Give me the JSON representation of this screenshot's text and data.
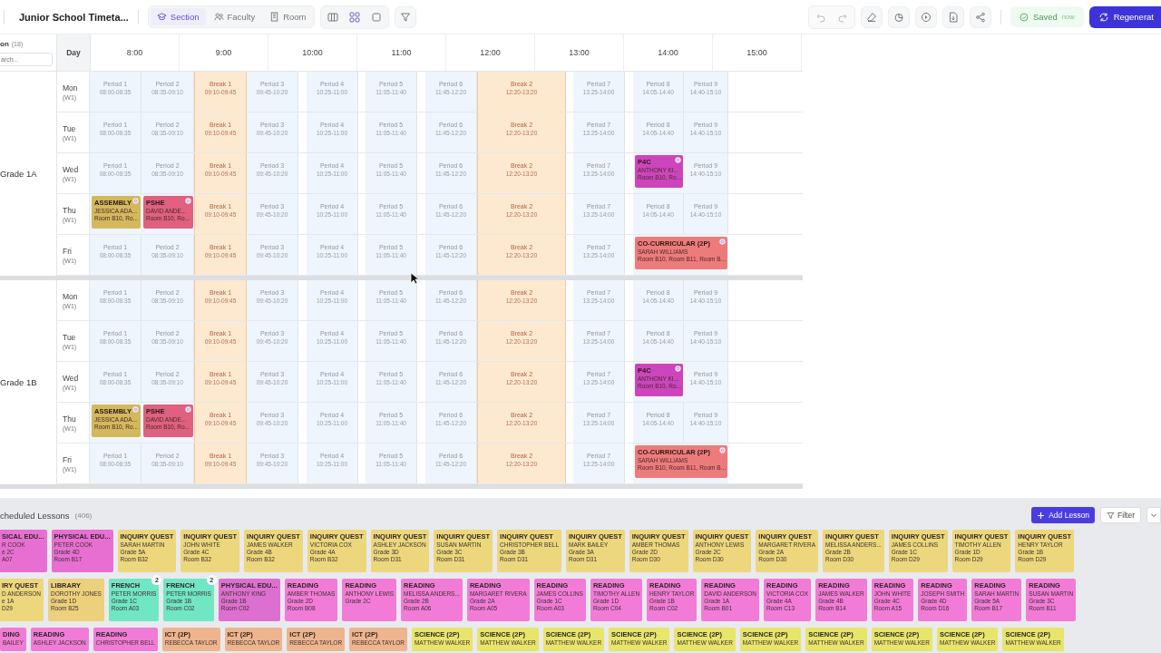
{
  "toolbar": {
    "title": "Junior School Timeta...",
    "views": [
      {
        "label": "Section",
        "selected": true
      },
      {
        "label": "Faculty",
        "selected": false
      },
      {
        "label": "Room",
        "selected": false
      }
    ],
    "layouts": [
      {
        "selected": false
      },
      {
        "selected": true
      },
      {
        "selected": false
      }
    ],
    "save_status": "Saved",
    "save_time": "now",
    "primary_button": "Regenerat"
  },
  "side_header": {
    "label": "on",
    "count": "(18)",
    "search": {
      "placeholder": "arch..."
    }
  },
  "timetable": {
    "day_heading": "Day",
    "hours": [
      "8:00",
      "9:00",
      "10:00",
      "11:00",
      "12:00",
      "13:00",
      "14:00",
      "15:00"
    ],
    "sections": [
      {
        "grade": "Grade 1A",
        "days": [
          {
            "day": "Mon",
            "week": "(W1)",
            "slots": [
              {
                "kind": "period",
                "label": "Period 1",
                "time": "08:00-08:35"
              },
              {
                "kind": "period",
                "label": "Period 2",
                "time": "08:35-09:10"
              },
              {
                "kind": "break",
                "label": "Break 1",
                "time": "09:10-09:45"
              },
              {
                "kind": "period",
                "label": "Period 3",
                "time": "09:45-10:20"
              },
              {
                "kind": "period",
                "label": "Period 4",
                "time": "10:25-11:00"
              },
              {
                "kind": "period",
                "label": "Period 5",
                "time": "11:05-11:40"
              },
              {
                "kind": "period",
                "label": "Period 6",
                "time": "11:45-12:20"
              },
              {
                "kind": "break",
                "label": "Break 2",
                "time": "12:20-13:20"
              },
              {
                "kind": "period",
                "label": "Period 7",
                "time": "13:25-14:00"
              },
              {
                "kind": "period",
                "label": "Period 8",
                "time": "14:05-14:40"
              },
              {
                "kind": "period",
                "label": "Period 9",
                "time": "14:40-15:10"
              }
            ]
          },
          {
            "day": "Tue",
            "week": "(W1)",
            "slots": [
              {
                "kind": "period",
                "label": "Period 1",
                "time": "08:00-08:35"
              },
              {
                "kind": "period",
                "label": "Period 2",
                "time": "08:35-09:10"
              },
              {
                "kind": "break",
                "label": "Break 1",
                "time": "09:10-09:45"
              },
              {
                "kind": "period",
                "label": "Period 3",
                "time": "09:45-10:20"
              },
              {
                "kind": "period",
                "label": "Period 4",
                "time": "10:25-11:00"
              },
              {
                "kind": "period",
                "label": "Period 5",
                "time": "11:05-11:40"
              },
              {
                "kind": "period",
                "label": "Period 6",
                "time": "11:45-12:20"
              },
              {
                "kind": "break",
                "label": "Break 2",
                "time": "12:20-13:20"
              },
              {
                "kind": "period",
                "label": "Period 7",
                "time": "13:25-14:00"
              },
              {
                "kind": "period",
                "label": "Period 8",
                "time": "14:05-14:40"
              },
              {
                "kind": "period",
                "label": "Period 9",
                "time": "14:40-15:10"
              }
            ]
          },
          {
            "day": "Wed",
            "week": "(W1)",
            "slots": [
              {
                "kind": "period",
                "label": "Period 1",
                "time": "08:00-08:35"
              },
              {
                "kind": "period",
                "label": "Period 2",
                "time": "08:35-09:10"
              },
              {
                "kind": "break",
                "label": "Break 1",
                "time": "09:10-09:45"
              },
              {
                "kind": "period",
                "label": "Period 3",
                "time": "09:45-10:20"
              },
              {
                "kind": "period",
                "label": "Period 4",
                "time": "10:25-11:00"
              },
              {
                "kind": "period",
                "label": "Period 5",
                "time": "11:05-11:40"
              },
              {
                "kind": "period",
                "label": "Period 6",
                "time": "11:45-12:20"
              },
              {
                "kind": "break",
                "label": "Break 2",
                "time": "12:20-13:20"
              },
              {
                "kind": "period",
                "label": "Period 7",
                "time": "13:25-14:00"
              },
              {
                "kind": "lesson",
                "subject": "P4C",
                "teacher": "ANTHONY KI...",
                "room": "Room B10, Ro...",
                "color": "#cc45bd",
                "double": false
              },
              {
                "kind": "period",
                "label": "Period 9",
                "time": "14:40-15:10"
              }
            ]
          },
          {
            "day": "Thu",
            "week": "(W1)",
            "slots": [
              {
                "kind": "lesson",
                "subject": "ASSEMBLY",
                "teacher": "JESSICA ADA...",
                "room": "Room B10, Ro...",
                "color": "#d4b85c",
                "double": false
              },
              {
                "kind": "lesson",
                "subject": "PSHE",
                "teacher": "DAVID ANDE...",
                "room": "Room B10, Ro...",
                "color": "#e0607f",
                "double": false
              },
              {
                "kind": "break",
                "label": "Break 1",
                "time": "09:10-09:45"
              },
              {
                "kind": "period",
                "label": "Period 3",
                "time": "09:45-10:20"
              },
              {
                "kind": "period",
                "label": "Period 4",
                "time": "10:25-11:00"
              },
              {
                "kind": "period",
                "label": "Period 5",
                "time": "11:05-11:40"
              },
              {
                "kind": "period",
                "label": "Period 6",
                "time": "11:45-12:20"
              },
              {
                "kind": "break",
                "label": "Break 2",
                "time": "12:20-13:20"
              },
              {
                "kind": "period",
                "label": "Period 7",
                "time": "13:25-14:00"
              },
              {
                "kind": "period",
                "label": "Period 8",
                "time": "14:05-14:40"
              },
              {
                "kind": "period",
                "label": "Period 9",
                "time": "14:40-15:10"
              }
            ]
          },
          {
            "day": "Fri",
            "week": "(W1)",
            "slots": [
              {
                "kind": "period",
                "label": "Period 1",
                "time": "08:00-08:35"
              },
              {
                "kind": "period",
                "label": "Period 2",
                "time": "08:35-09:10"
              },
              {
                "kind": "break",
                "label": "Break 1",
                "time": "09:10-09:45"
              },
              {
                "kind": "period",
                "label": "Period 3",
                "time": "09:45-10:20"
              },
              {
                "kind": "period",
                "label": "Period 4",
                "time": "10:25-11:00"
              },
              {
                "kind": "period",
                "label": "Period 5",
                "time": "11:05-11:40"
              },
              {
                "kind": "period",
                "label": "Period 6",
                "time": "11:45-12:20"
              },
              {
                "kind": "break",
                "label": "Break 2",
                "time": "12:20-13:20"
              },
              {
                "kind": "period",
                "label": "Period 7",
                "time": "13:25-14:00"
              },
              {
                "kind": "lesson",
                "subject": "CO-CURRICULAR (2P)",
                "teacher": "SARAH WILLIAMS",
                "room": "Room B10, Room B11, Room B...",
                "color": "#ee7b7b",
                "double": true
              }
            ]
          }
        ]
      },
      {
        "grade": "Grade 1B",
        "days": [
          {
            "day": "Mon",
            "week": "(W1)",
            "slots": [
              {
                "kind": "period",
                "label": "Period 1",
                "time": "08:00-08:35"
              },
              {
                "kind": "period",
                "label": "Period 2",
                "time": "08:35-09:10"
              },
              {
                "kind": "break",
                "label": "Break 1",
                "time": "09:10-09:45"
              },
              {
                "kind": "period",
                "label": "Period 3",
                "time": "09:45-10:20"
              },
              {
                "kind": "period",
                "label": "Period 4",
                "time": "10:25-11:00"
              },
              {
                "kind": "period",
                "label": "Period 5",
                "time": "11:05-11:40"
              },
              {
                "kind": "period",
                "label": "Period 6",
                "time": "11:45-12:20"
              },
              {
                "kind": "break",
                "label": "Break 2",
                "time": "12:20-13:20"
              },
              {
                "kind": "period",
                "label": "Period 7",
                "time": "13:25-14:00"
              },
              {
                "kind": "period",
                "label": "Period 8",
                "time": "14:05-14:40"
              },
              {
                "kind": "period",
                "label": "Period 9",
                "time": "14:40-15:10"
              }
            ]
          },
          {
            "day": "Tue",
            "week": "(W1)",
            "slots": [
              {
                "kind": "period",
                "label": "Period 1",
                "time": "08:00-08:35"
              },
              {
                "kind": "period",
                "label": "Period 2",
                "time": "08:35-09:10"
              },
              {
                "kind": "break",
                "label": "Break 1",
                "time": "09:10-09:45"
              },
              {
                "kind": "period",
                "label": "Period 3",
                "time": "09:45-10:20"
              },
              {
                "kind": "period",
                "label": "Period 4",
                "time": "10:25-11:00"
              },
              {
                "kind": "period",
                "label": "Period 5",
                "time": "11:05-11:40"
              },
              {
                "kind": "period",
                "label": "Period 6",
                "time": "11:45-12:20"
              },
              {
                "kind": "break",
                "label": "Break 2",
                "time": "12:20-13:20"
              },
              {
                "kind": "period",
                "label": "Period 7",
                "time": "13:25-14:00"
              },
              {
                "kind": "period",
                "label": "Period 8",
                "time": "14:05-14:40"
              },
              {
                "kind": "period",
                "label": "Period 9",
                "time": "14:40-15:10"
              }
            ]
          },
          {
            "day": "Wed",
            "week": "(W1)",
            "slots": [
              {
                "kind": "period",
                "label": "Period 1",
                "time": "08:00-08:35"
              },
              {
                "kind": "period",
                "label": "Period 2",
                "time": "08:35-09:10"
              },
              {
                "kind": "break",
                "label": "Break 1",
                "time": "09:10-09:45"
              },
              {
                "kind": "period",
                "label": "Period 3",
                "time": "09:45-10:20"
              },
              {
                "kind": "period",
                "label": "Period 4",
                "time": "10:25-11:00"
              },
              {
                "kind": "period",
                "label": "Period 5",
                "time": "11:05-11:40"
              },
              {
                "kind": "period",
                "label": "Period 6",
                "time": "11:45-12:20"
              },
              {
                "kind": "break",
                "label": "Break 2",
                "time": "12:20-13:20"
              },
              {
                "kind": "period",
                "label": "Period 7",
                "time": "13:25-14:00"
              },
              {
                "kind": "lesson",
                "subject": "P4C",
                "teacher": "ANTHONY KI...",
                "room": "Room B10, Ro...",
                "color": "#cc45bd",
                "double": false
              },
              {
                "kind": "period",
                "label": "Period 9",
                "time": "14:40-15:10"
              }
            ]
          },
          {
            "day": "Thu",
            "week": "(W1)",
            "slots": [
              {
                "kind": "lesson",
                "subject": "ASSEMBLY",
                "teacher": "JESSICA ADA...",
                "room": "Room B10, Ro...",
                "color": "#d4b85c",
                "double": false
              },
              {
                "kind": "lesson",
                "subject": "PSHE",
                "teacher": "DAVID ANDE...",
                "room": "Room B10, Ro...",
                "color": "#e0607f",
                "double": false
              },
              {
                "kind": "break",
                "label": "Break 1",
                "time": "09:10-09:45"
              },
              {
                "kind": "period",
                "label": "Period 3",
                "time": "09:45-10:20"
              },
              {
                "kind": "period",
                "label": "Period 4",
                "time": "10:25-11:00"
              },
              {
                "kind": "period",
                "label": "Period 5",
                "time": "11:05-11:40"
              },
              {
                "kind": "period",
                "label": "Period 6",
                "time": "11:45-12:20"
              },
              {
                "kind": "break",
                "label": "Break 2",
                "time": "12:20-13:20"
              },
              {
                "kind": "period",
                "label": "Period 7",
                "time": "13:25-14:00"
              },
              {
                "kind": "period",
                "label": "Period 8",
                "time": "14:05-14:40"
              },
              {
                "kind": "period",
                "label": "Period 9",
                "time": "14:40-15:10"
              }
            ]
          },
          {
            "day": "Fri",
            "week": "(W1)",
            "slots": [
              {
                "kind": "period",
                "label": "Period 1",
                "time": "08:00-08:35"
              },
              {
                "kind": "period",
                "label": "Period 2",
                "time": "08:35-09:10"
              },
              {
                "kind": "break",
                "label": "Break 1",
                "time": "09:10-09:45"
              },
              {
                "kind": "period",
                "label": "Period 3",
                "time": "09:45-10:20"
              },
              {
                "kind": "period",
                "label": "Period 4",
                "time": "10:25-11:00"
              },
              {
                "kind": "period",
                "label": "Period 5",
                "time": "11:05-11:40"
              },
              {
                "kind": "period",
                "label": "Period 6",
                "time": "11:45-12:20"
              },
              {
                "kind": "break",
                "label": "Break 2",
                "time": "12:20-13:20"
              },
              {
                "kind": "period",
                "label": "Period 7",
                "time": "13:25-14:00"
              },
              {
                "kind": "lesson",
                "subject": "CO-CURRICULAR (2P)",
                "teacher": "SARAH WILLIAMS",
                "room": "Room B10, Room B11, Room B...",
                "color": "#ee7b7b",
                "double": true
              }
            ]
          }
        ]
      }
    ]
  },
  "unscheduled": {
    "title": "cheduled Lessons",
    "count": "(406)",
    "add_button": "Add Lesson",
    "filter_button": "Filter",
    "rows": [
      {
        "cards": [
          {
            "subject": "SICAL EDU...",
            "teacher": "R COOK",
            "grade": "e 2C",
            "room": "A07",
            "color": "#e76fd2"
          },
          {
            "subject": "PHYSICAL EDU...",
            "teacher": "PETER COOK",
            "grade": "Grade 4D",
            "room": "Room B17",
            "color": "#e76fd2"
          },
          {
            "subject": "INQUIRY QUEST",
            "teacher": "SARAH MARTIN",
            "grade": "Grade 5A",
            "room": "Room B32",
            "color": "#ecd77c"
          },
          {
            "subject": "INQUIRY QUEST",
            "teacher": "JOHN WHITE",
            "grade": "Grade 4C",
            "room": "Room B32",
            "color": "#ecd77c"
          },
          {
            "subject": "INQUIRY QUEST",
            "teacher": "JAMES WALKER",
            "grade": "Grade 4B",
            "room": "Room B32",
            "color": "#ecd77c"
          },
          {
            "subject": "INQUIRY QUEST",
            "teacher": "VICTORIA COX",
            "grade": "Grade 4A",
            "room": "Room B32",
            "color": "#ecd77c"
          },
          {
            "subject": "INQUIRY QUEST",
            "teacher": "ASHLEY JACKSON",
            "grade": "Grade 3D",
            "room": "Room D31",
            "color": "#ecd77c"
          },
          {
            "subject": "INQUIRY QUEST",
            "teacher": "SUSAN MARTIN",
            "grade": "Grade 3C",
            "room": "Room D31",
            "color": "#ecd77c"
          },
          {
            "subject": "INQUIRY QUEST",
            "teacher": "CHRISTOPHER BELL",
            "grade": "Grade 3B",
            "room": "Room D31",
            "color": "#ecd77c"
          },
          {
            "subject": "INQUIRY QUEST",
            "teacher": "MARK BAILEY",
            "grade": "Grade 3A",
            "room": "Room D31",
            "color": "#ecd77c"
          },
          {
            "subject": "INQUIRY QUEST",
            "teacher": "AMBER THOMAS",
            "grade": "Grade 2D",
            "room": "Room D30",
            "color": "#ecd77c"
          },
          {
            "subject": "INQUIRY QUEST",
            "teacher": "ANTHONY LEWIS",
            "grade": "Grade 2C",
            "room": "Room D30",
            "color": "#ecd77c"
          },
          {
            "subject": "INQUIRY QUEST",
            "teacher": "MARGARET RIVERA",
            "grade": "Grade 2A",
            "room": "Room D30",
            "color": "#ecd77c"
          },
          {
            "subject": "INQUIRY QUEST",
            "teacher": "MELISSA ANDERS...",
            "grade": "Grade 2B",
            "room": "Room D30",
            "color": "#ecd77c"
          },
          {
            "subject": "INQUIRY QUEST",
            "teacher": "JAMES COLLINS",
            "grade": "Grade 1C",
            "room": "Room D29",
            "color": "#ecd77c"
          },
          {
            "subject": "INQUIRY QUEST",
            "teacher": "TIMOTHY ALLEN",
            "grade": "Grade 1D",
            "room": "Room D29",
            "color": "#ecd77c"
          },
          {
            "subject": "INQUIRY QUEST",
            "teacher": "HENRY TAYLOR",
            "grade": "Grade 1B",
            "room": "Room D29",
            "color": "#ecd77c"
          }
        ]
      },
      {
        "cards": [
          {
            "subject": "IRY QUEST",
            "teacher": "D ANDERSON",
            "grade": "e 1A",
            "room": "D29",
            "color": "#ecd77c"
          },
          {
            "subject": "LIBRARY",
            "teacher": "DOROTHY JONES",
            "grade": "Grade 1D",
            "room": "Room B25",
            "color": "#ecd07c"
          },
          {
            "subject": "FRENCH",
            "teacher": "PETER MORRIS",
            "grade": "Grade 1C",
            "room": "Room A03",
            "color": "#70e6c4",
            "badge": "2"
          },
          {
            "subject": "FRENCH",
            "teacher": "PETER MORRIS",
            "grade": "Grade 1B",
            "room": "Room C02",
            "color": "#70e6c4",
            "badge": "2"
          },
          {
            "subject": "PHYSICAL EDU...",
            "teacher": "ANTHONY KING",
            "grade": "Grade 1B",
            "room": "Room C02",
            "color": "#dd6fd0"
          },
          {
            "subject": "READING",
            "teacher": "AMBER THOMAS",
            "grade": "Grade 2D",
            "room": "Room B08",
            "color": "#f27bd8"
          },
          {
            "subject": "READING",
            "teacher": "ANTHONY LEWIS",
            "grade": "Grade 2C",
            "color": "#f27bd8"
          },
          {
            "subject": "READING",
            "teacher": "MELISSA ANDERS...",
            "grade": "Grade 2B",
            "room": "Room A06",
            "color": "#f27bd8"
          },
          {
            "subject": "READING",
            "teacher": "MARGARET RIVERA",
            "grade": "Grade 2A",
            "room": "Room A05",
            "color": "#f27bd8"
          },
          {
            "subject": "READING",
            "teacher": "JAMES COLLINS",
            "grade": "Grade 1C",
            "room": "Room A03",
            "color": "#f27bd8"
          },
          {
            "subject": "READING",
            "teacher": "TIMOTHY ALLEN",
            "grade": "Grade 1D",
            "room": "Room C04",
            "color": "#f27bd8"
          },
          {
            "subject": "READING",
            "teacher": "HENRY TAYLOR",
            "grade": "Grade 1B",
            "room": "Room C02",
            "color": "#f27bd8"
          },
          {
            "subject": "READING",
            "teacher": "DAVID ANDERSON",
            "grade": "Grade 1A",
            "room": "Room B01",
            "color": "#f27bd8"
          },
          {
            "subject": "READING",
            "teacher": "VICTORIA COX",
            "grade": "Grade 4A",
            "room": "Room C13",
            "color": "#f27bd8"
          },
          {
            "subject": "READING",
            "teacher": "JAMES WALKER",
            "grade": "Grade 4B",
            "room": "Room B14",
            "color": "#f27bd8"
          },
          {
            "subject": "READING",
            "teacher": "JOHN WHITE",
            "grade": "Grade 4C",
            "room": "Room A15",
            "color": "#f27bd8"
          },
          {
            "subject": "READING",
            "teacher": "JOSEPH SMITH",
            "grade": "Grade 4D",
            "room": "Room D16",
            "color": "#f27bd8"
          },
          {
            "subject": "READING",
            "teacher": "SARAH MARTIN",
            "grade": "Grade 5A",
            "room": "Room B17",
            "color": "#f27bd8"
          },
          {
            "subject": "READING",
            "teacher": "SUSAN MARTIN",
            "grade": "Grade 3C",
            "room": "Room B11",
            "color": "#f27bd8"
          }
        ]
      },
      {
        "cards": [
          {
            "subject": "DING",
            "teacher": "BAILEY",
            "color": "#f27bd8"
          },
          {
            "subject": "READING",
            "teacher": "ASHLEY JACKSON",
            "color": "#f27bd8"
          },
          {
            "subject": "READING",
            "teacher": "CHRISTOPHER BELL",
            "color": "#f27bd8"
          },
          {
            "subject": "ICT (2P)",
            "teacher": "REBECCA TAYLOR",
            "color": "#eeb48d"
          },
          {
            "subject": "ICT (2P)",
            "teacher": "REBECCA TAYLOR",
            "color": "#eeb48d"
          },
          {
            "subject": "ICT (2P)",
            "teacher": "REBECCA TAYLOR",
            "color": "#eeb48d"
          },
          {
            "subject": "ICT (2P)",
            "teacher": "REBECCA TAYLOR",
            "color": "#eeb48d"
          },
          {
            "subject": "SCIENCE (2P)",
            "teacher": "MATTHEW WALKER",
            "color": "#e7e56a"
          },
          {
            "subject": "SCIENCE (2P)",
            "teacher": "MATTHEW WALKER",
            "color": "#e7e56a"
          },
          {
            "subject": "SCIENCE (2P)",
            "teacher": "MATTHEW WALKER",
            "color": "#e7e56a"
          },
          {
            "subject": "SCIENCE (2P)",
            "teacher": "MATTHEW WALKER",
            "color": "#e7e56a"
          },
          {
            "subject": "SCIENCE (2P)",
            "teacher": "MATTHEW WALKER",
            "color": "#e7e56a"
          },
          {
            "subject": "SCIENCE (2P)",
            "teacher": "MATTHEW WALKER",
            "color": "#e7e56a"
          },
          {
            "subject": "SCIENCE (2P)",
            "teacher": "MATTHEW WALKER",
            "color": "#e7e56a"
          },
          {
            "subject": "SCIENCE (2P)",
            "teacher": "MATTHEW WALKER",
            "color": "#e7e56a"
          },
          {
            "subject": "SCIENCE (2P)",
            "teacher": "MATTHEW WALKER",
            "color": "#e7e56a"
          },
          {
            "subject": "SCIENCE (2P)",
            "teacher": "MATTHEW WALKER",
            "color": "#e7e56a"
          }
        ]
      }
    ]
  }
}
